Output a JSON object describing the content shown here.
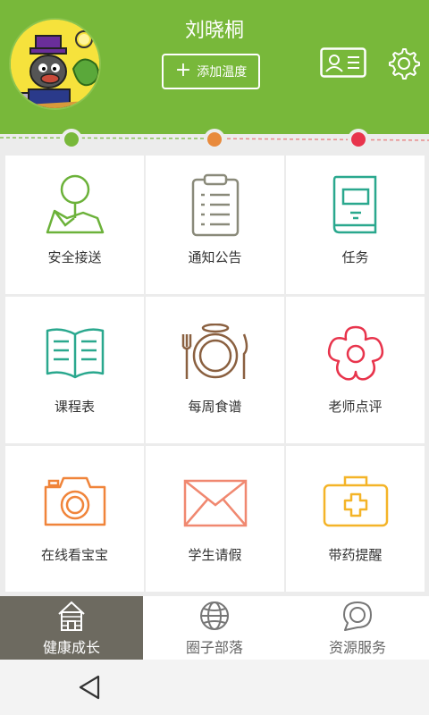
{
  "header": {
    "user_name": "刘晓桐",
    "add_temp_label": "添加温度",
    "bg_color": "#78b83a"
  },
  "timeline": {
    "dots": [
      "#78b83a",
      "#e88a3c",
      "#e8344c"
    ]
  },
  "grid": [
    {
      "label": "安全接送",
      "icon": "map-pin-icon",
      "color": "#6cb23a"
    },
    {
      "label": "通知公告",
      "icon": "clipboard-icon",
      "color": "#8a8a7a"
    },
    {
      "label": "任务",
      "icon": "book-icon",
      "color": "#2aa88e"
    },
    {
      "label": "课程表",
      "icon": "open-book-icon",
      "color": "#2aa88e"
    },
    {
      "label": "每周食谱",
      "icon": "plate-cutlery-icon",
      "color": "#8a6040"
    },
    {
      "label": "老师点评",
      "icon": "flower-icon",
      "color": "#e8344c"
    },
    {
      "label": "在线看宝宝",
      "icon": "camera-icon",
      "color": "#f0843a"
    },
    {
      "label": "学生请假",
      "icon": "envelope-icon",
      "color": "#f08870"
    },
    {
      "label": "带药提醒",
      "icon": "medical-kit-icon",
      "color": "#f4b428"
    }
  ],
  "tabbar": {
    "tabs": [
      {
        "label": "健康成长",
        "icon": "house-icon",
        "active": true
      },
      {
        "label": "圈子部落",
        "icon": "globe-icon",
        "active": false
      },
      {
        "label": "资源服务",
        "icon": "chat-bubble-icon",
        "active": false
      }
    ]
  }
}
